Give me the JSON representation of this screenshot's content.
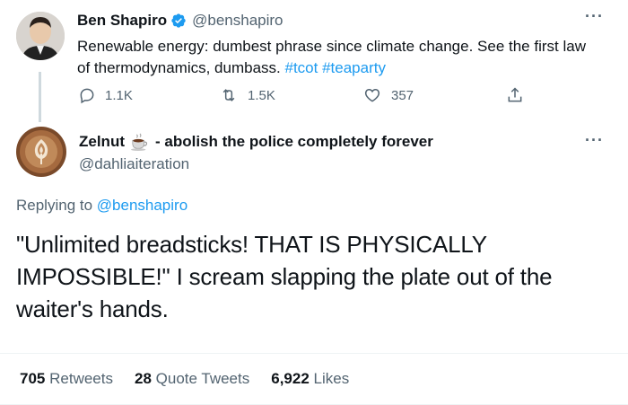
{
  "original_tweet": {
    "author_name": "Ben Shapiro",
    "handle": "@benshapiro",
    "text_plain": "Renewable energy: dumbest phrase since climate change. See the first law of thermodynamics, dumbass. ",
    "hashtag1": "#tcot",
    "hashtag2": "#teaparty",
    "replies": "1.1K",
    "retweets": "1.5K",
    "likes": "357"
  },
  "reply_tweet": {
    "author_name": "Zelnut",
    "author_suffix": "- abolish the police completely forever",
    "handle": "@dahliaiteration",
    "replying_label": "Replying to ",
    "replying_to": "@benshapiro",
    "text": "\"Unlimited breadsticks! THAT IS PHYSICALLY IMPOSSIBLE!\" I scream slapping the plate out of the waiter's hands.",
    "retweets_count": "705",
    "retweets_label": "Retweets",
    "quote_count": "28",
    "quote_label": "Quote Tweets",
    "likes_count": "6,922",
    "likes_label": "Likes"
  },
  "colors": {
    "accent": "#1d9bf0",
    "muted": "#536471",
    "text": "#0f1419"
  },
  "icons": [
    "verified-badge-icon",
    "reply-icon",
    "retweet-icon",
    "like-icon",
    "share-icon",
    "more-icon",
    "coffee-emoji-icon"
  ]
}
